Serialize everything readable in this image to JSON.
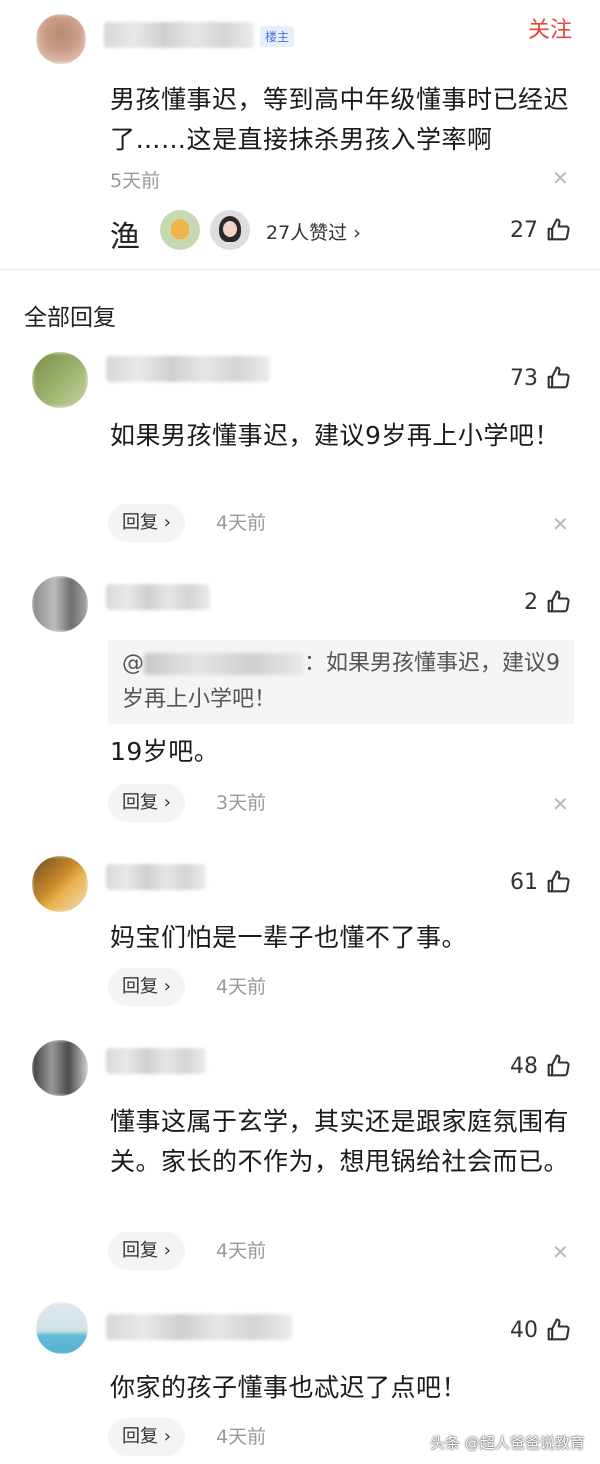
{
  "top_comment": {
    "author_badge": "楼主",
    "follow_label": "关注",
    "text": "男孩懂事迟，等到高中年级懂事时已经迟了……这是直接抹杀男孩入学率啊",
    "time": "5天前",
    "liker_avatar_char": "渔",
    "likers_label": "27人赞过 ›",
    "like_count": "27"
  },
  "section_title": "全部回复",
  "replies": [
    {
      "text": "如果男孩懂事迟，建议9岁再上小学吧！",
      "like_count": "73",
      "reply_label": "回复 ›",
      "time": "4天前"
    },
    {
      "quote_prefix": "@",
      "quote_text": "：如果男孩懂事迟，建议9岁再上小学吧！",
      "text": "19岁吧。",
      "like_count": "2",
      "reply_label": "回复 ›",
      "time": "3天前"
    },
    {
      "text": "妈宝们怕是一辈子也懂不了事。",
      "like_count": "61",
      "reply_label": "回复 ›",
      "time": "4天前"
    },
    {
      "text": "懂事这属于玄学，其实还是跟家庭氛围有关。家长的不作为，想甩锅给社会而已。",
      "like_count": "48",
      "reply_label": "回复 ›",
      "time": "4天前"
    },
    {
      "text": "你家的孩子懂事也忒迟了点吧！",
      "like_count": "40",
      "reply_label": "回复 ›",
      "time": "4天前"
    }
  ],
  "watermark": "头条 @超人爸爸说教育",
  "icons": {
    "like": "thumbs-up-icon",
    "close": "close-icon"
  },
  "colors": {
    "follow": "#e8453c",
    "badge_bg": "#e7eefc",
    "badge_text": "#4a74d8"
  }
}
